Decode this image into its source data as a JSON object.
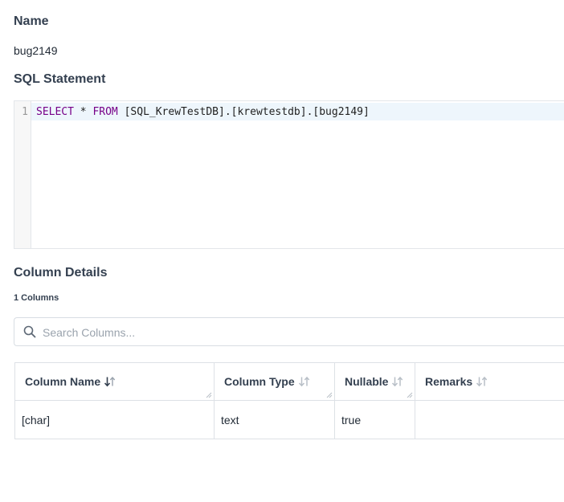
{
  "name_section": {
    "heading": "Name",
    "value": "bug2149"
  },
  "sql_section": {
    "heading": "SQL Statement",
    "line_number": "1",
    "keyword_select": "SELECT",
    "star": " * ",
    "keyword_from": "FROM",
    "rest": " [SQL_KrewTestDB].[krewtestdb].[bug2149]"
  },
  "columns_section": {
    "heading": "Column Details",
    "count": "1 Columns",
    "search": {
      "placeholder": "Search Columns...",
      "icon": "search-icon"
    },
    "headers": [
      "Column Name",
      "Column Type",
      "Nullable",
      "Remarks"
    ],
    "rows": [
      [
        "[char]",
        "text",
        "true",
        ""
      ]
    ],
    "colors": {
      "sort_active": "#344050",
      "sort_inactive": "#b8bfc7"
    }
  }
}
